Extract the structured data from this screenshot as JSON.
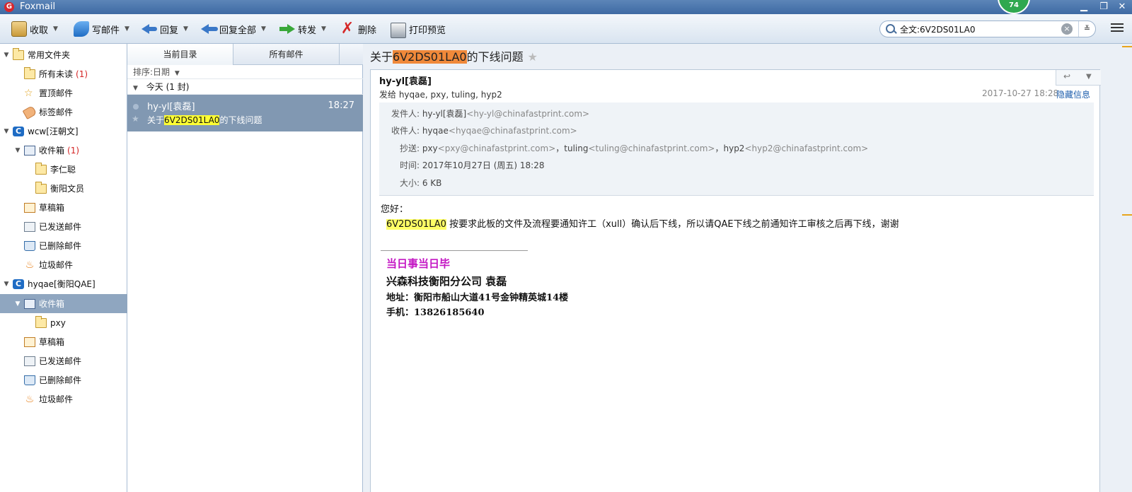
{
  "app": {
    "title": "Foxmail",
    "badge": "74"
  },
  "toolbar": {
    "receive": "收取",
    "write": "写邮件",
    "reply": "回复",
    "reply_all": "回复全部",
    "forward": "转发",
    "delete": "删除",
    "print_preview": "打印预览",
    "search_value": "全文:6V2DS01LA0"
  },
  "folders": {
    "common": "常用文件夹",
    "all_unread": "所有未读",
    "all_unread_count": "(1)",
    "pinned": "置顶邮件",
    "tagged": "标签邮件",
    "acct1": "wcw[汪朝文]",
    "acct1_inbox": "收件箱",
    "acct1_inbox_count": "(1)",
    "acct1_sub1": "李仁聪",
    "acct1_sub2": "衡阳文员",
    "acct1_drafts": "草稿箱",
    "acct1_sent": "已发送邮件",
    "acct1_deleted": "已删除邮件",
    "acct1_junk": "垃圾邮件",
    "acct2": "hyqae[衡阳QAE]",
    "acct2_inbox": "收件箱",
    "acct2_sub1": "pxy",
    "acct2_drafts": "草稿箱",
    "acct2_sent": "已发送邮件",
    "acct2_deleted": "已删除邮件",
    "acct2_junk": "垃圾邮件"
  },
  "list": {
    "tab_current": "当前目录",
    "tab_all": "所有邮件",
    "sort": "排序:日期",
    "group": "今天 (1 封)",
    "msg_from": "hy-yl[袁磊]",
    "msg_time": "18:27",
    "msg_subj_pre": "关于",
    "msg_subj_hl": "6V2DS01LA0",
    "msg_subj_post": "的下线问题"
  },
  "mail": {
    "title_pre": "关于",
    "title_hl": "6V2DS01LA0",
    "title_post": "的下线问题",
    "sender": "hy-yl[袁磊]",
    "send_to": "发给 hyqae, pxy, tuling, hyp2",
    "date": "2017-10-27 18:28",
    "hide_info": "隐藏信息",
    "from_label": "发件人:",
    "from_name": "hy-yl[袁磊]",
    "from_email": "<hy-yl@chinafastprint.com>",
    "to_label": "收件人:",
    "to_name": "hyqae",
    "to_email": "<hyqae@chinafastprint.com>",
    "cc_label": "抄送:",
    "cc1_name": "pxy",
    "cc1_email": "<pxy@chinafastprint.com>",
    "cc2_name": "tuling",
    "cc2_email": "<tuling@chinafastprint.com>",
    "cc3_name": "hyp2",
    "cc3_email": "<hyp2@chinafastprint.com>",
    "cc_sep": "，",
    "time_label": "时间:",
    "time_value": "2017年10月27日 (周五) 18:28",
    "size_label": "大小:",
    "size_value": "6 KB",
    "greeting": "您好：",
    "body_hl": "6V2DS01LA0",
    "body_text": " 按要求此板的文件及流程要通知许工（xull）确认后下线，所以请QAE下线之前通知许工审核之后再下线，谢谢",
    "sig1": "当日事当日毕",
    "sig2": "兴森科技衡阳分公司    袁磊",
    "sig3": "地址：衡阳市船山大道41号金钟精英城14楼",
    "sig4": "手机：13826185640"
  },
  "colors": {
    "selection": "#8198b2",
    "highlight": "#ffff33",
    "title_highlight": "#f0893a",
    "signature": "#c416c4"
  }
}
